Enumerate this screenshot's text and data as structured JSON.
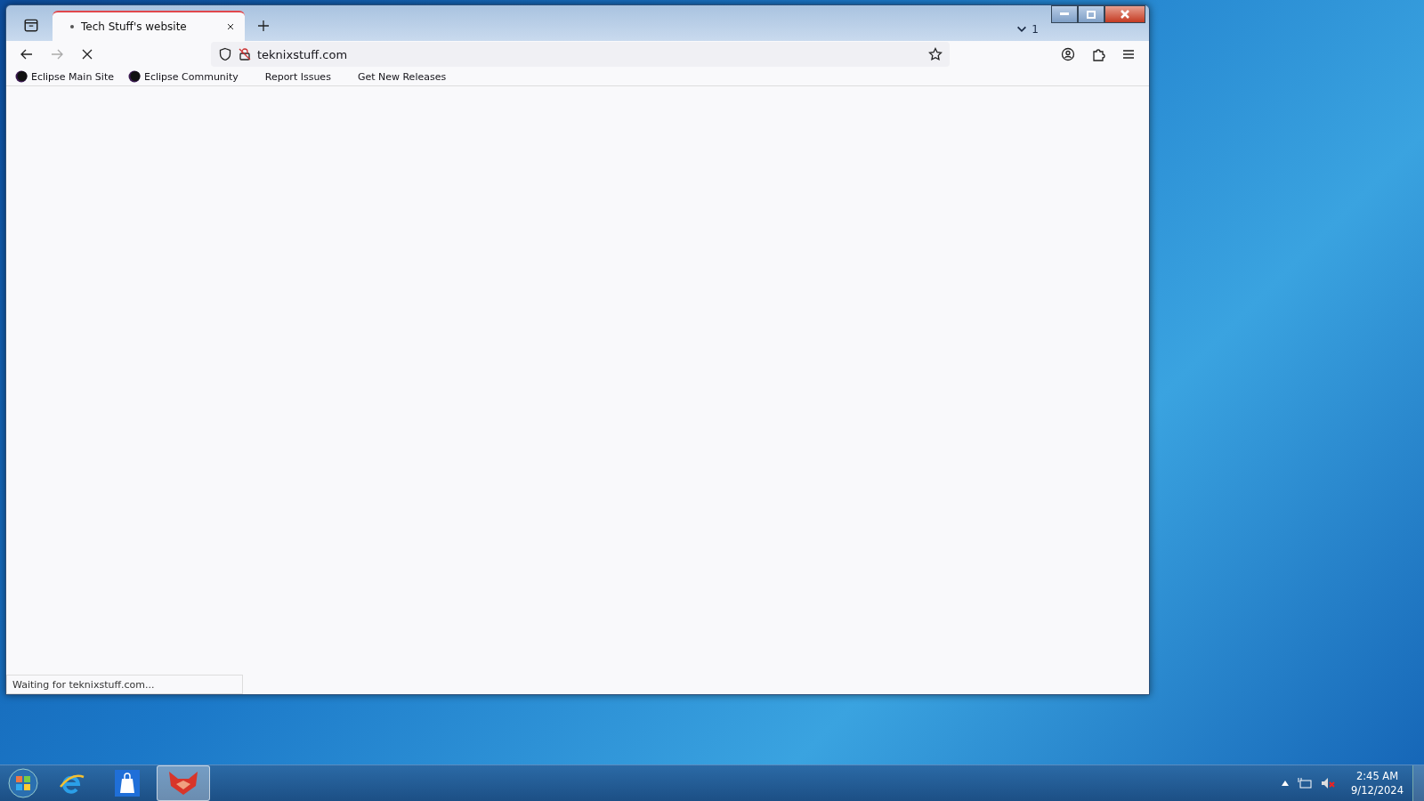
{
  "browser": {
    "tabs": [
      {
        "title": "Tech Stuff's website",
        "selected": true
      }
    ],
    "tab_count": "1",
    "address": "teknixstuff.com",
    "bookmarks": [
      {
        "label": "Eclipse Main Site",
        "kind": "favicon"
      },
      {
        "label": "Eclipse Community",
        "kind": "favicon"
      },
      {
        "label": "Report Issues",
        "kind": "plain"
      },
      {
        "label": "Get New Releases",
        "kind": "plain"
      }
    ],
    "status": "Waiting for teknixstuff.com..."
  },
  "taskbar": {
    "apps": [
      {
        "kind": "browser",
        "selected": false
      },
      {
        "kind": "store",
        "selected": false
      },
      {
        "kind": "fox",
        "selected": true
      }
    ],
    "clock": {
      "time": "2:45 AM",
      "date": "9/12/2024"
    }
  }
}
